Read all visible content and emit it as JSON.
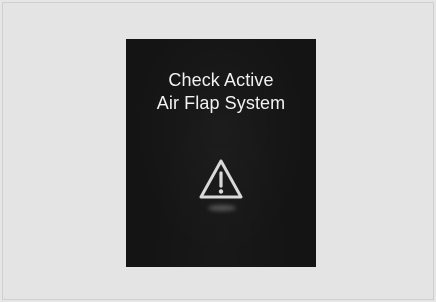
{
  "message": {
    "line1": "Check Active",
    "line2": "Air Flap System"
  },
  "icons": {
    "warning": "warning-triangle-icon"
  },
  "colors": {
    "page_background": "#e6e6e6",
    "display_background": "#141414",
    "text": "#f2f2f2",
    "icon": "#d9d9d9"
  }
}
